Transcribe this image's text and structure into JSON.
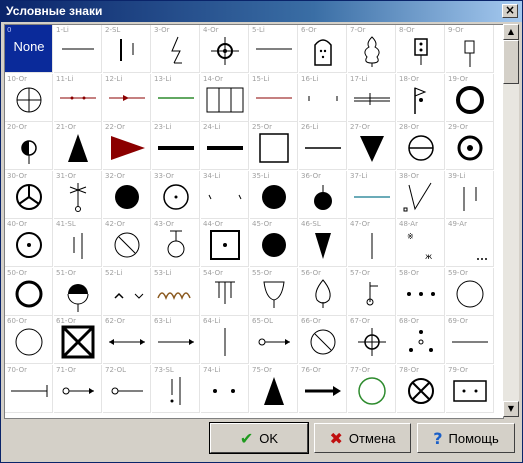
{
  "window": {
    "title": "Условные знаки",
    "close_glyph": "×"
  },
  "buttons": {
    "ok": "OK",
    "cancel": "Отмена",
    "help": "Помощь"
  },
  "icons": {
    "ok": "check-icon",
    "cancel": "x-icon",
    "help": "question-icon"
  },
  "selected_label": "None",
  "colors": {
    "titlebar": "#0a246a",
    "selection": "#0a2a9a",
    "red_symbol": "#8b0000",
    "green_symbol": "#2e8b2e"
  },
  "cells": [
    "0",
    "1-Li",
    "2-SL",
    "3-Or",
    "4-Or",
    "5-Li",
    "6-Or",
    "7-Or",
    "8-Or",
    "9-Or",
    "10-Or",
    "11-Li",
    "12-Li",
    "13-Li",
    "14-Or",
    "15-Li",
    "16-Li",
    "17-Li",
    "18-Or",
    "19-Or",
    "20-Or",
    "21-Or",
    "22-Or",
    "23-Li",
    "24-Li",
    "25-Or",
    "26-Li",
    "27-Or",
    "28-Or",
    "29-Or",
    "30-Or",
    "31-Or",
    "32-Or",
    "33-Or",
    "34-Li",
    "35-Li",
    "36-Or",
    "37-Li",
    "38-Or",
    "39-Li",
    "40-Or",
    "41-SL",
    "42-Or",
    "43-Or",
    "44-Or",
    "45-Or",
    "46-SL",
    "47-Or",
    "48-Ar",
    "49-Ar",
    "50-Or",
    "51-Or",
    "52-Li",
    "53-Li",
    "54-Or",
    "55-Or",
    "56-Or",
    "57-Or",
    "58-Or",
    "59-Or",
    "60-Or",
    "61-Or",
    "62-Or",
    "63-Li",
    "64-Li",
    "65-OL",
    "66-Or",
    "67-Or",
    "68-Or",
    "69-Or",
    "70-Or",
    "71-Or",
    "72-OL",
    "73-SL",
    "74-Li",
    "75-Or",
    "76-Or",
    "77-Or",
    "78-Or",
    "79-Or"
  ]
}
